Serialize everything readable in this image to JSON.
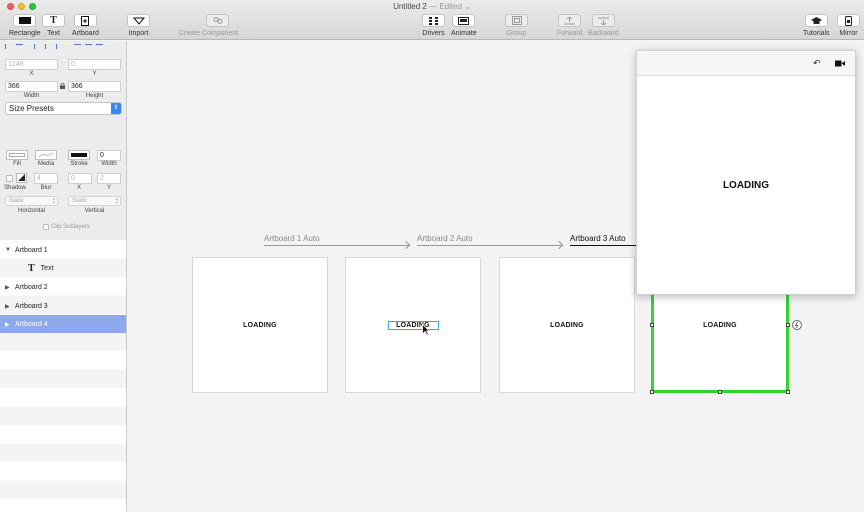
{
  "window": {
    "title": "Untitled 2",
    "edited": "— Edited ⌄"
  },
  "toolbar": {
    "rectangle": "Rectangle",
    "text": "Text",
    "text_glyph": "T",
    "artboard": "Artboard",
    "import": "Import",
    "create_component": "Create Component",
    "drivers": "Drivers",
    "animate": "Animate",
    "group": "Group",
    "forward": "Forward",
    "backward": "Backward",
    "tutorials": "Tutorials",
    "mirror": "Mirror"
  },
  "inspector": {
    "x_value": "1248",
    "x_label": "X",
    "y_value": "0",
    "y_label": "Y",
    "width_value": "366",
    "width_label": "Width",
    "height_value": "366",
    "height_label": "Height",
    "size_presets": "Size Presets",
    "fill_label": "Fill",
    "media_label": "Media",
    "stroke_label": "Stroke",
    "stroke_width_value": "0",
    "stroke_width_label": "Width",
    "shadow_label": "Shadow",
    "blur_label": "Blur",
    "blur_value": "4",
    "shadow_x_label": "X",
    "shadow_x_value": "0",
    "shadow_y_label": "Y",
    "shadow_y_value": "2",
    "horizontal_value": "Static",
    "horizontal_label": "Horizontal",
    "vertical_value": "Static",
    "vertical_label": "Vertical",
    "clip_sublayers": "Clip Sublayers"
  },
  "layers": [
    {
      "name": "Artboard 1",
      "expanded": true
    },
    {
      "name": "Text",
      "child": true
    },
    {
      "name": "Artboard 2"
    },
    {
      "name": "Artboard 3"
    },
    {
      "name": "Artboard 4",
      "selected": true
    }
  ],
  "canvas": {
    "connectors": [
      "Artboard 1 Auto",
      "Artboard 2 Auto",
      "Artboard 3 Auto"
    ],
    "artboard_text": "LOADING"
  },
  "preview": {
    "text": "LOADING"
  },
  "colors": {
    "selection_green": "#34d233",
    "selection_blue": "#39a8e0",
    "layer_selected": "#8fa9ee"
  }
}
